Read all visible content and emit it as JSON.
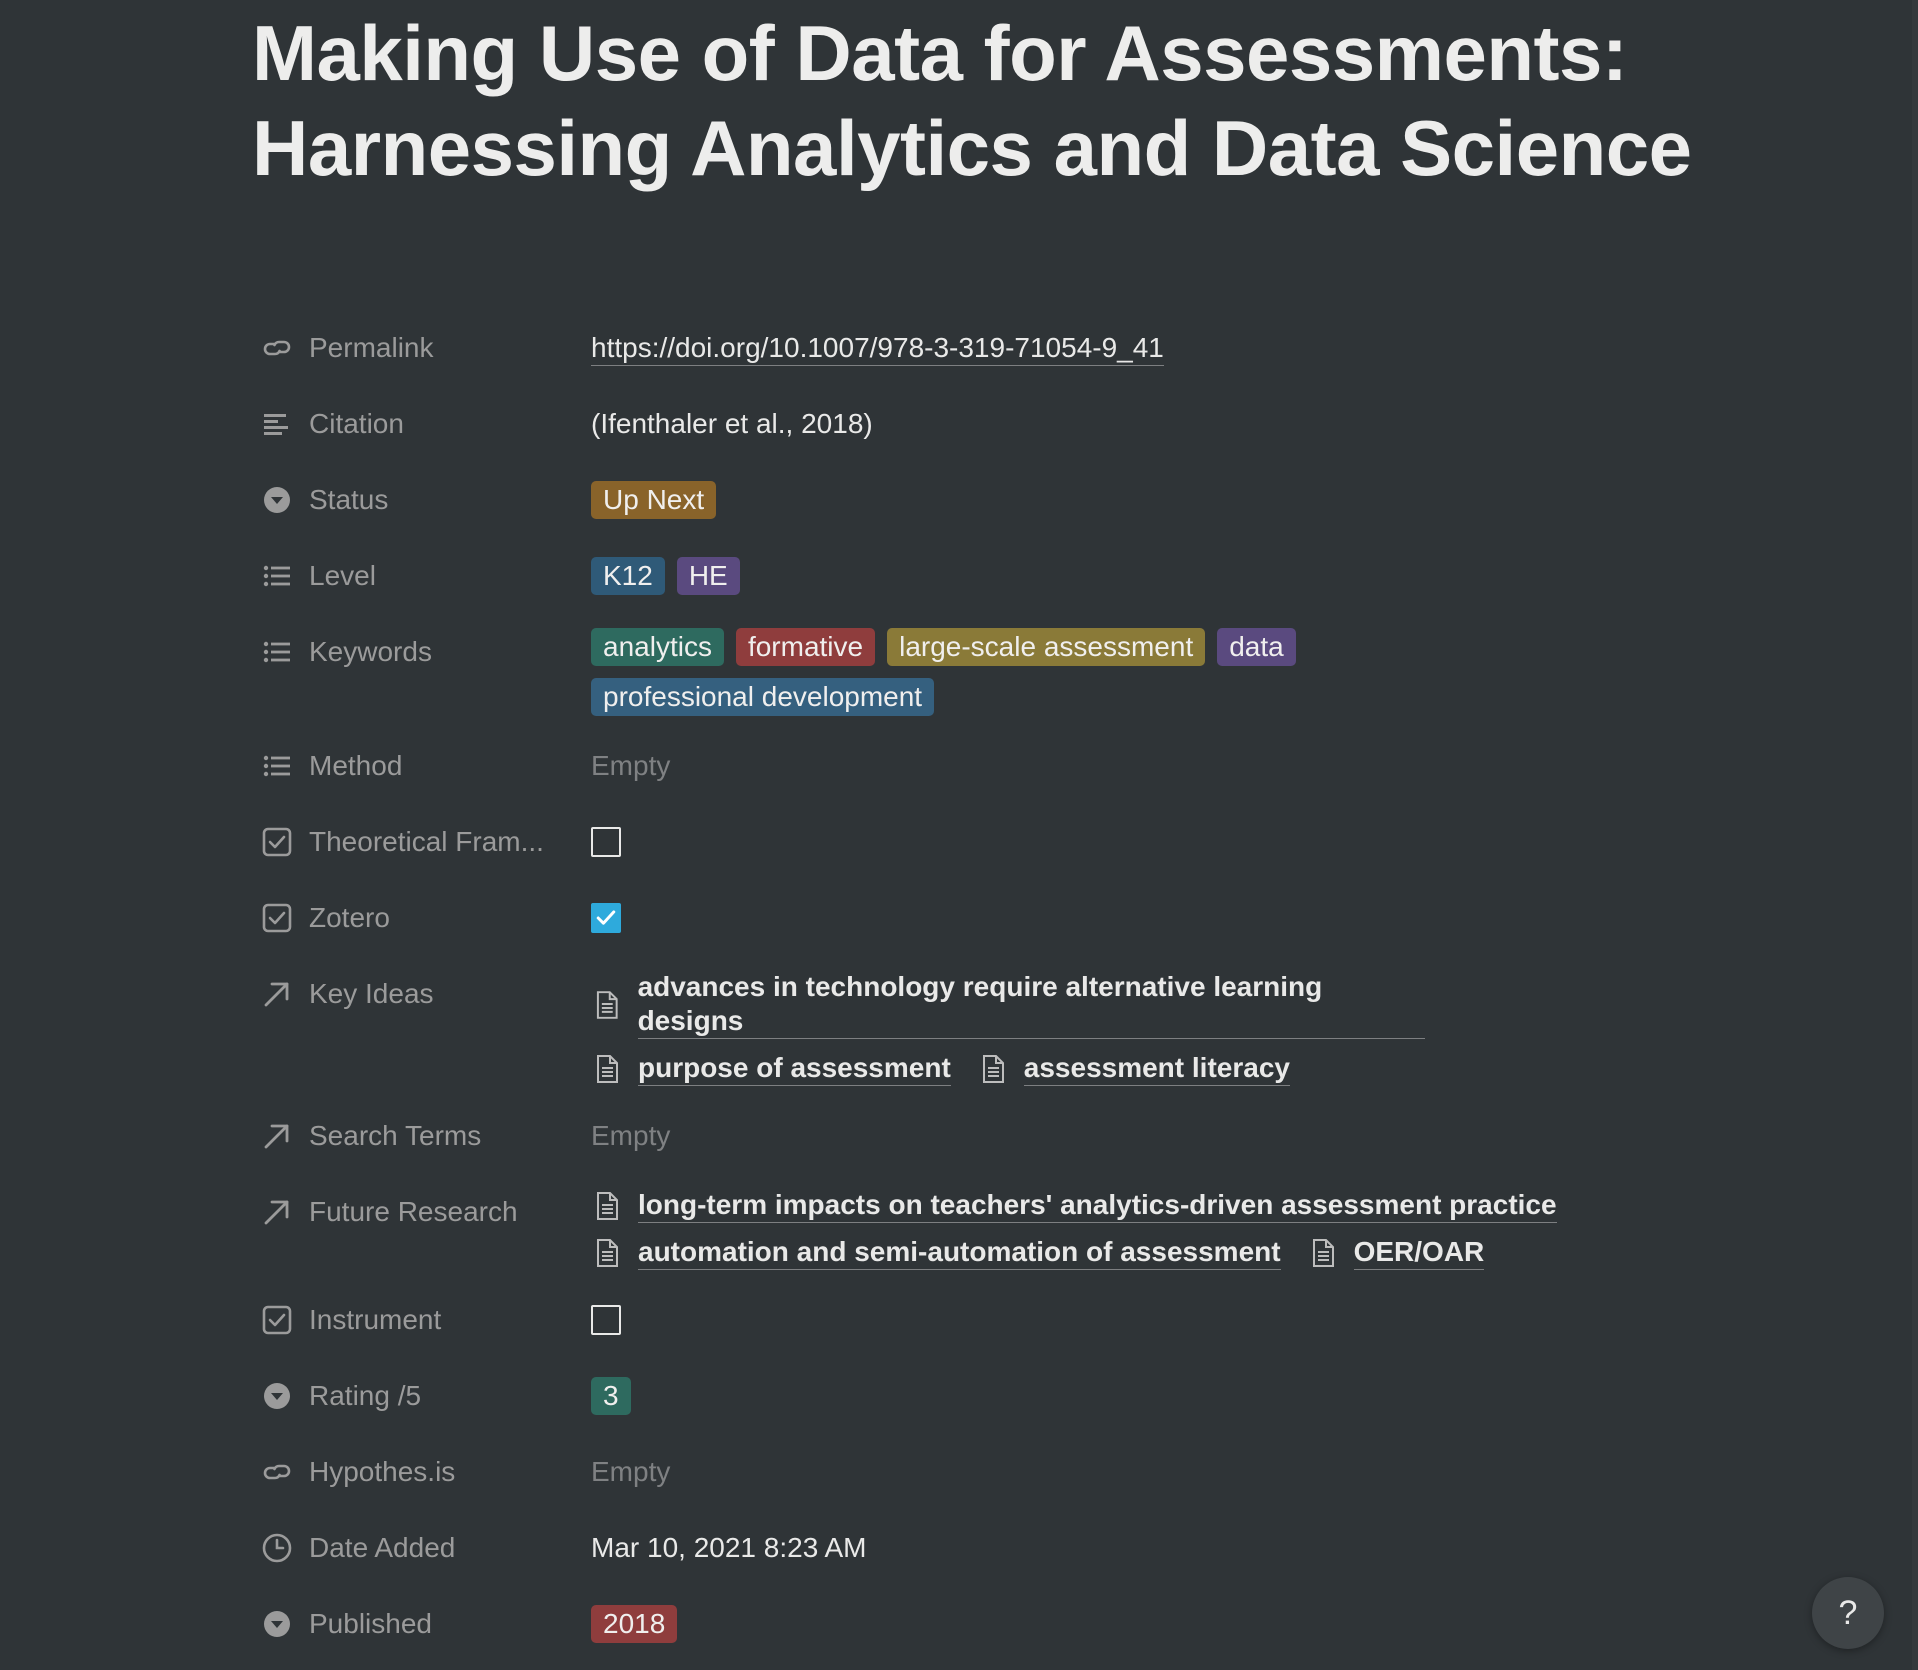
{
  "page": {
    "title": "Making Use of Data for Assessments: Harnessing Analytics and Data Science"
  },
  "properties": {
    "permalink": {
      "label": "Permalink",
      "icon": "link-icon",
      "value": "https://doi.org/10.1007/978-3-319-71054-9_41"
    },
    "citation": {
      "label": "Citation",
      "icon": "text-icon",
      "value": "(Ifenthaler et al., 2018)"
    },
    "status": {
      "label": "Status",
      "icon": "select-icon",
      "value": "Up Next",
      "color": "#89632a"
    },
    "level": {
      "label": "Level",
      "icon": "multi-select-icon",
      "tags": [
        {
          "text": "K12",
          "color": "#2f5a78"
        },
        {
          "text": "HE",
          "color": "#5a4a7f"
        }
      ]
    },
    "keywords": {
      "label": "Keywords",
      "icon": "multi-select-icon",
      "tags": [
        {
          "text": "analytics",
          "color": "#2e6a5f"
        },
        {
          "text": "formative",
          "color": "#8f3d3d"
        },
        {
          "text": "large-scale assessment",
          "color": "#8a7a38"
        },
        {
          "text": "data",
          "color": "#5a4a7f"
        },
        {
          "text": "professional development",
          "color": "#35607f"
        }
      ]
    },
    "method": {
      "label": "Method",
      "icon": "multi-select-icon",
      "value": "Empty"
    },
    "theoretical_framework": {
      "label": "Theoretical Fram...",
      "icon": "checkbox-icon",
      "checked": false
    },
    "zotero": {
      "label": "Zotero",
      "icon": "checkbox-icon",
      "checked": true
    },
    "key_ideas": {
      "label": "Key Ideas",
      "icon": "relation-arrow-icon",
      "pages": [
        "advances in technology require alternative learning designs",
        "purpose of assessment",
        "assessment literacy"
      ]
    },
    "search_terms": {
      "label": "Search Terms",
      "icon": "relation-arrow-icon",
      "value": "Empty"
    },
    "future_research": {
      "label": "Future Research",
      "icon": "relation-arrow-icon",
      "pages": [
        "long-term impacts on teachers' analytics-driven assessment practice",
        "automation and semi-automation of assessment",
        "OER/OAR"
      ]
    },
    "instrument": {
      "label": "Instrument",
      "icon": "checkbox-icon",
      "checked": false
    },
    "rating": {
      "label": "Rating /5",
      "icon": "select-icon",
      "value": "3",
      "color": "#2e6a5f"
    },
    "hypothesis": {
      "label": "Hypothes.is",
      "icon": "link-icon",
      "value": "Empty"
    },
    "date_added": {
      "label": "Date Added",
      "icon": "clock-icon",
      "value": "Mar 10, 2021 8:23 AM"
    },
    "published": {
      "label": "Published",
      "icon": "select-icon",
      "value": "2018",
      "color": "#8f3d3d"
    }
  },
  "help": {
    "label": "?"
  }
}
